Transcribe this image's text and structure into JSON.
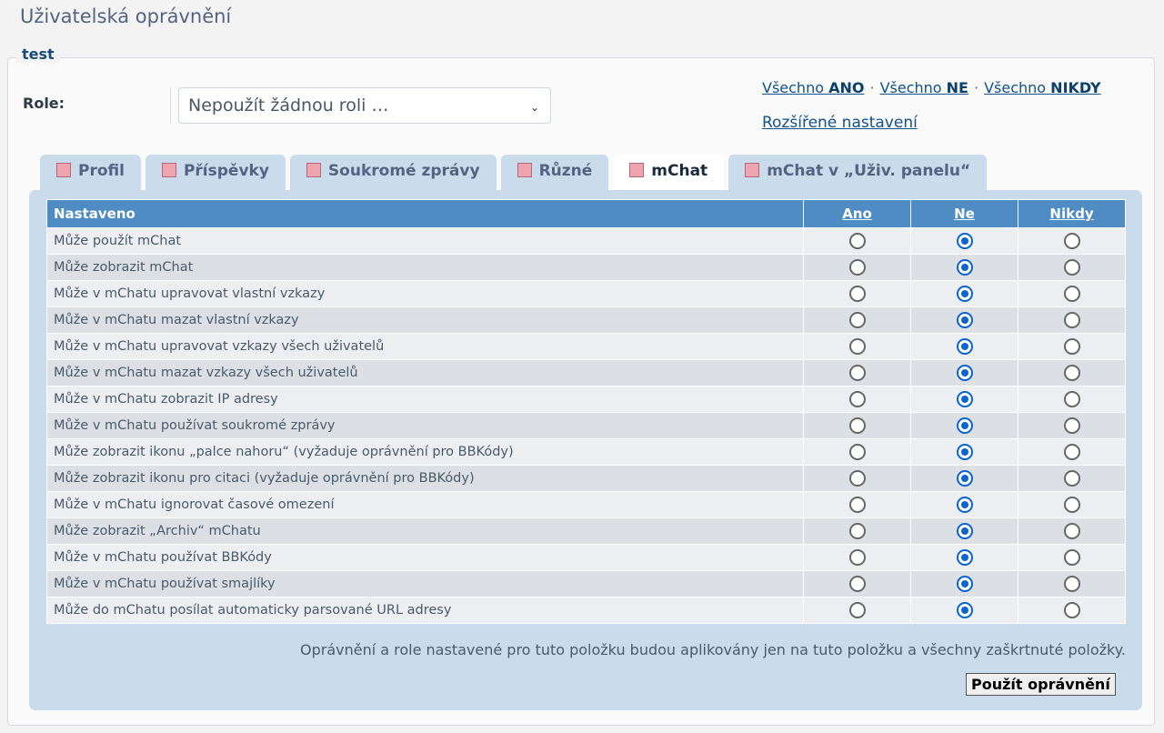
{
  "page": {
    "title": "Uživatelská oprávnění"
  },
  "group": {
    "legend": "test"
  },
  "role": {
    "label": "Role:",
    "selected": "Nepoužít žádnou roli …"
  },
  "quick_links": {
    "all_yes_prefix": "Všechno",
    "all_yes": "ANO",
    "all_no_prefix": "Všechno",
    "all_no": "NE",
    "all_never_prefix": "Všechno",
    "all_never": "NIKDY",
    "separator": "·",
    "advanced": "Rozšířené nastavení"
  },
  "tabs": [
    {
      "label": "Profil",
      "active": false
    },
    {
      "label": "Příspěvky",
      "active": false
    },
    {
      "label": "Soukromé zprávy",
      "active": false
    },
    {
      "label": "Různé",
      "active": false
    },
    {
      "label": "mChat",
      "active": true
    },
    {
      "label": "mChat v „Uživ. panelu“",
      "active": false
    }
  ],
  "table": {
    "headers": {
      "label": "Nastaveno",
      "yes": "Ano",
      "no": "Ne",
      "never": "Nikdy"
    },
    "rows": [
      {
        "label": "Může použít mChat",
        "value": "no"
      },
      {
        "label": "Může zobrazit mChat",
        "value": "no"
      },
      {
        "label": "Může v mChatu upravovat vlastní vzkazy",
        "value": "no"
      },
      {
        "label": "Může v mChatu mazat vlastní vzkazy",
        "value": "no"
      },
      {
        "label": "Může v mChatu upravovat vzkazy všech uživatelů",
        "value": "no"
      },
      {
        "label": "Může v mChatu mazat vzkazy všech uživatelů",
        "value": "no"
      },
      {
        "label": "Může v mChatu zobrazit IP adresy",
        "value": "no"
      },
      {
        "label": "Může v mChatu používat soukromé zprávy",
        "value": "no"
      },
      {
        "label": "Může zobrazit ikonu „palce nahoru“ (vyžaduje oprávnění pro BBKódy)",
        "value": "no"
      },
      {
        "label": "Může zobrazit ikonu pro citaci (vyžaduje oprávnění pro BBKódy)",
        "value": "no"
      },
      {
        "label": "Může v mChatu ignorovat časové omezení",
        "value": "no"
      },
      {
        "label": "Může zobrazit „Archiv“ mChatu",
        "value": "no"
      },
      {
        "label": "Může v mChatu používat BBKódy",
        "value": "no"
      },
      {
        "label": "Může v mChatu používat smajlíky",
        "value": "no"
      },
      {
        "label": "Může do mChatu posílat automaticky parsované URL adresy",
        "value": "no"
      }
    ]
  },
  "note": "Oprávnění a role nastavené pro tuto položku budou aplikovány jen na tuto položku a všechny zaškrtnuté položky.",
  "apply_button": "Použít oprávnění"
}
